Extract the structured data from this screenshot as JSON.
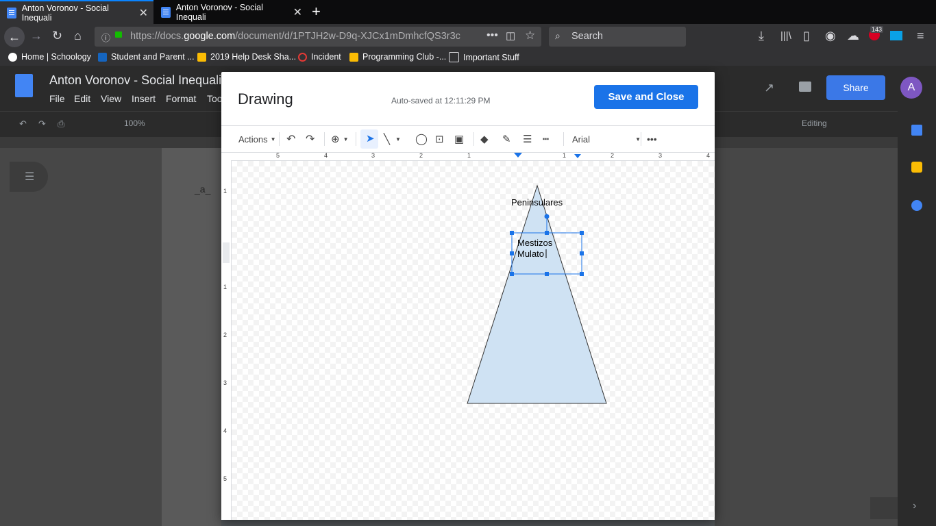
{
  "browser": {
    "tabs": [
      {
        "title": "Anton Voronov - Social Inequali"
      },
      {
        "title": "Anton Voronov - Social Inequali"
      }
    ],
    "url_prefix": "https://docs.",
    "url_domain": "google.com",
    "url_path": "/document/d/1PTJH2w-D9q-XJCx1mDmhcfQS3r3c",
    "search_placeholder": "Search",
    "badge_count": "143",
    "bookmarks": [
      {
        "label": "Home | Schoology"
      },
      {
        "label": "Student and Parent ..."
      },
      {
        "label": "2019 Help Desk Sha..."
      },
      {
        "label": "Incident"
      },
      {
        "label": "Programming Club -..."
      },
      {
        "label": "Important Stuff"
      }
    ]
  },
  "docs": {
    "title": "Anton Voronov - Social Inequali",
    "menus": [
      "File",
      "Edit",
      "View",
      "Insert",
      "Format",
      "Too"
    ],
    "zoom": "100%",
    "share_label": "Share",
    "avatar_letter": "A",
    "editing_label": "Editing",
    "page_text": "_a_"
  },
  "drawing": {
    "title": "Drawing",
    "autosave": "Auto-saved at 12:11:29 PM",
    "save_close": "Save and Close",
    "toolbar": {
      "actions_label": "Actions",
      "font": "Arial"
    },
    "ruler_h": [
      "5",
      "4",
      "3",
      "2",
      "1",
      "1",
      "2",
      "3",
      "4"
    ],
    "ruler_v": [
      "1",
      "1",
      "2",
      "3",
      "4",
      "5"
    ],
    "labels": {
      "top": "Peninsulares",
      "middle_line1": "Mestizos",
      "middle_line2": "Mulato"
    }
  },
  "colors": {
    "accent": "#1a73e8",
    "shape_fill": "#cfe2f3",
    "selection": "#1a73e8"
  }
}
